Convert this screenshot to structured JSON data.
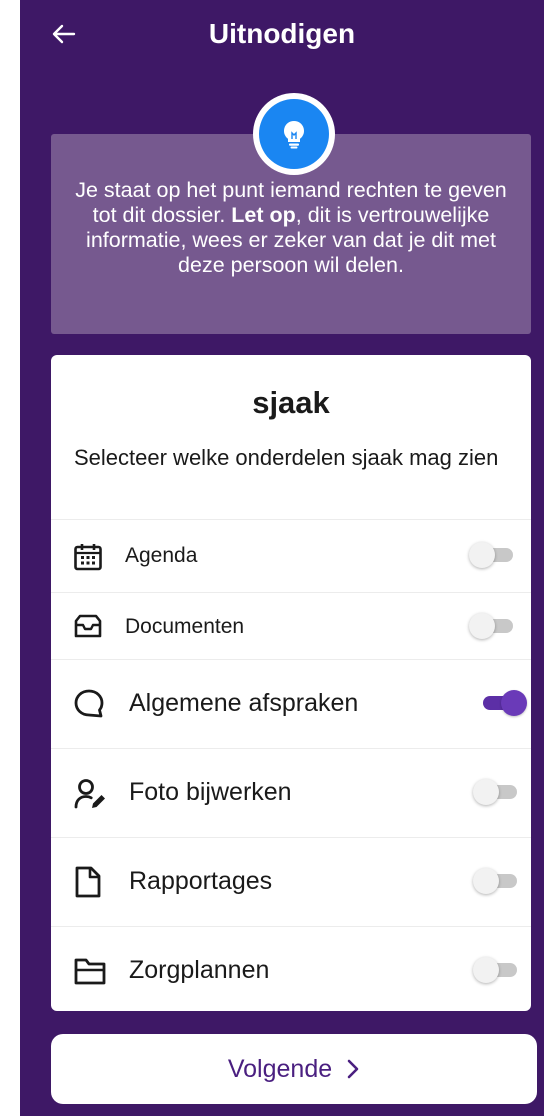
{
  "header": {
    "title": "Uitnodigen"
  },
  "notice": {
    "line_1": "Je staat op het punt iemand rechten te geven tot dit dossier.",
    "emphasis": "Let op",
    "line_2": ", dit is vertrouwelijke informatie, wees er zeker van dat je dit met deze persoon wil delen.",
    "icon": "lightbulb-icon"
  },
  "card": {
    "name": "sjaak",
    "subtitle": "Selecteer welke onderdelen sjaak mag zien",
    "permissions": [
      {
        "label": "Agenda",
        "icon": "calendar-icon",
        "enabled": false
      },
      {
        "label": "Documenten",
        "icon": "inbox-icon",
        "enabled": false
      },
      {
        "label": "Algemene afspraken",
        "icon": "chat-bubble-icon",
        "enabled": true
      },
      {
        "label": "Foto bijwerken",
        "icon": "user-edit-icon",
        "enabled": false
      },
      {
        "label": "Rapportages",
        "icon": "document-icon",
        "enabled": false
      },
      {
        "label": "Zorgplannen",
        "icon": "folder-icon",
        "enabled": false
      }
    ]
  },
  "footer": {
    "next_label": "Volgende"
  },
  "colors": {
    "background": "#3e1866",
    "notice_bg": "#76598f",
    "accent_blue": "#1a86f2",
    "toggle_on": "#6a3ab8",
    "button_text": "#4a1f80"
  }
}
